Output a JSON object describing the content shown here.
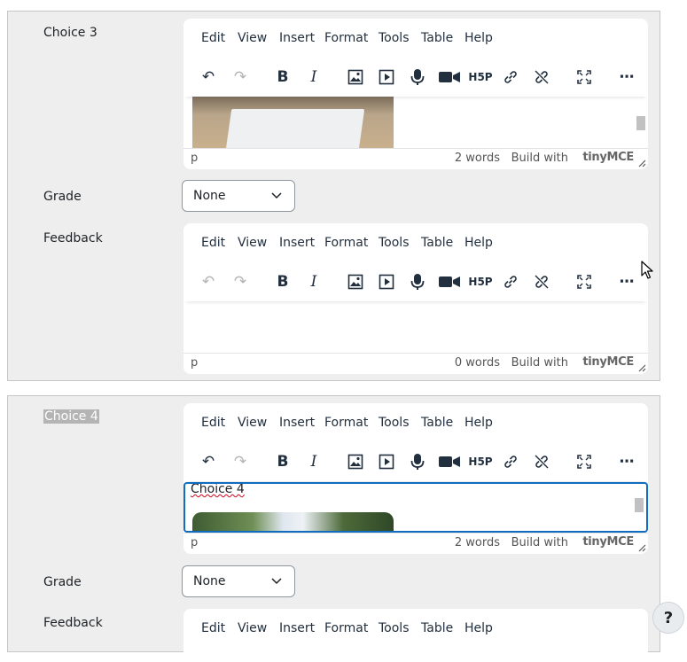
{
  "menus": [
    "Edit",
    "View",
    "Insert",
    "Format",
    "Tools",
    "Table",
    "Help"
  ],
  "toolbar_icons": [
    "undo-icon",
    "redo-icon",
    "bold-icon",
    "italic-icon",
    "image-icon",
    "media-icon",
    "record-audio-icon",
    "record-video-icon",
    "h5p-icon",
    "link-icon",
    "unlink-icon",
    "fullscreen-icon",
    "more-icon"
  ],
  "statusbar": {
    "path": "p",
    "build_with": "Build with",
    "brand": "tinyMCE"
  },
  "choice3": {
    "label": "Choice 3",
    "words": "2 words",
    "grade_label": "Grade",
    "grade_value": "None",
    "feedback_label": "Feedback",
    "feedback_words": "0 words"
  },
  "choice4": {
    "label": "Choice 4",
    "content_text": "Choice 4",
    "words": "2 words",
    "grade_label": "Grade",
    "grade_value": "None",
    "feedback_label": "Feedback"
  },
  "help_label": "?",
  "colors": {
    "panel_bg": "#eeeeee",
    "focus_border": "#0f6cbf",
    "text": "#1d2125"
  }
}
